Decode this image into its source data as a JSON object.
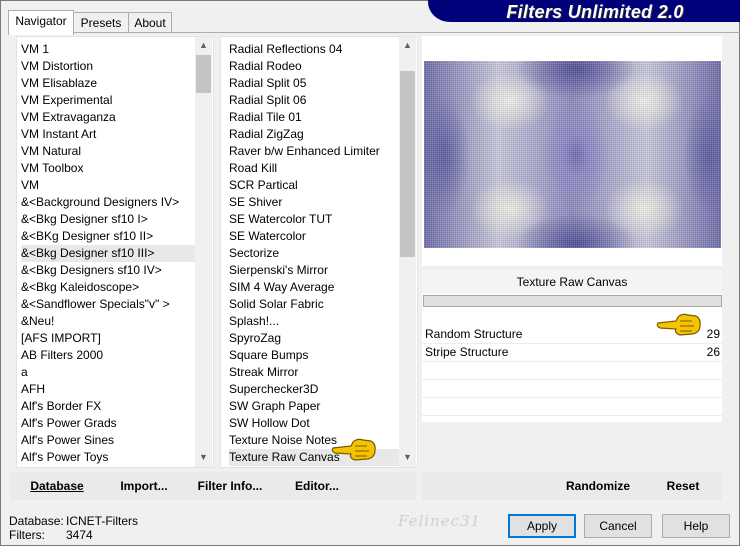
{
  "banner": {
    "title": "Filters Unlimited 2.0"
  },
  "tabs": [
    {
      "label": "Navigator",
      "active": true
    },
    {
      "label": "Presets",
      "active": false
    },
    {
      "label": "About",
      "active": false
    }
  ],
  "categories": {
    "items": [
      "VM 1",
      "VM Distortion",
      "VM Elisablaze",
      "VM Experimental",
      "VM Extravaganza",
      "VM Instant Art",
      "VM Natural",
      "VM Toolbox",
      "VM",
      "&<Background Designers IV>",
      "&<Bkg Designer sf10 I>",
      "&<BKg Designer sf10 II>",
      "&<Bkg Designer sf10 III>",
      "&<Bkg Designers sf10 IV>",
      "&<Bkg Kaleidoscope>",
      "&<Sandflower Specials\"v\" >",
      "&Neu!",
      "[AFS IMPORT]",
      "AB Filters 2000",
      "a",
      "AFH",
      "Alf's Border FX",
      "Alf's Power Grads",
      "Alf's Power Sines",
      "Alf's Power Toys"
    ],
    "selected_index": 12
  },
  "filters": {
    "items": [
      "Radial Reflections 04",
      "Radial Rodeo",
      "Radial Split 05",
      "Radial Split 06",
      "Radial Tile 01",
      "Radial ZigZag",
      "Raver b/w Enhanced Limiter",
      "Road Kill",
      "SCR  Partical",
      "SE Shiver",
      "SE Watercolor TUT",
      "SE Watercolor",
      "Sectorize",
      "Sierpenski's Mirror",
      "SIM 4 Way Average",
      "Solid Solar Fabric",
      "Splash!...",
      "SpyroZag",
      "Square Bumps",
      "Streak Mirror",
      "Superchecker3D",
      "SW Graph Paper",
      "SW Hollow Dot",
      "Texture Noise Notes",
      "Texture Raw Canvas"
    ],
    "selected_index": 24
  },
  "params": {
    "title": "Texture Raw Canvas",
    "rows": [
      {
        "name": "Random Structure",
        "value": "29"
      },
      {
        "name": "Stripe Structure",
        "value": "26"
      }
    ]
  },
  "toolbar": {
    "database": "Database",
    "import": "Import...",
    "filter_info": "Filter Info...",
    "editor": "Editor...",
    "randomize": "Randomize",
    "reset": "Reset"
  },
  "status": {
    "database_label": "Database:",
    "database_value": "ICNET-Filters",
    "filters_label": "Filters:",
    "filters_value": "3474",
    "watermark": "Felinec31"
  },
  "dialog": {
    "apply": "Apply",
    "cancel": "Cancel",
    "help": "Help"
  },
  "colors": {
    "banner": "#00007b",
    "default_button_border": "#0078d7",
    "hand": "#f5c400"
  }
}
